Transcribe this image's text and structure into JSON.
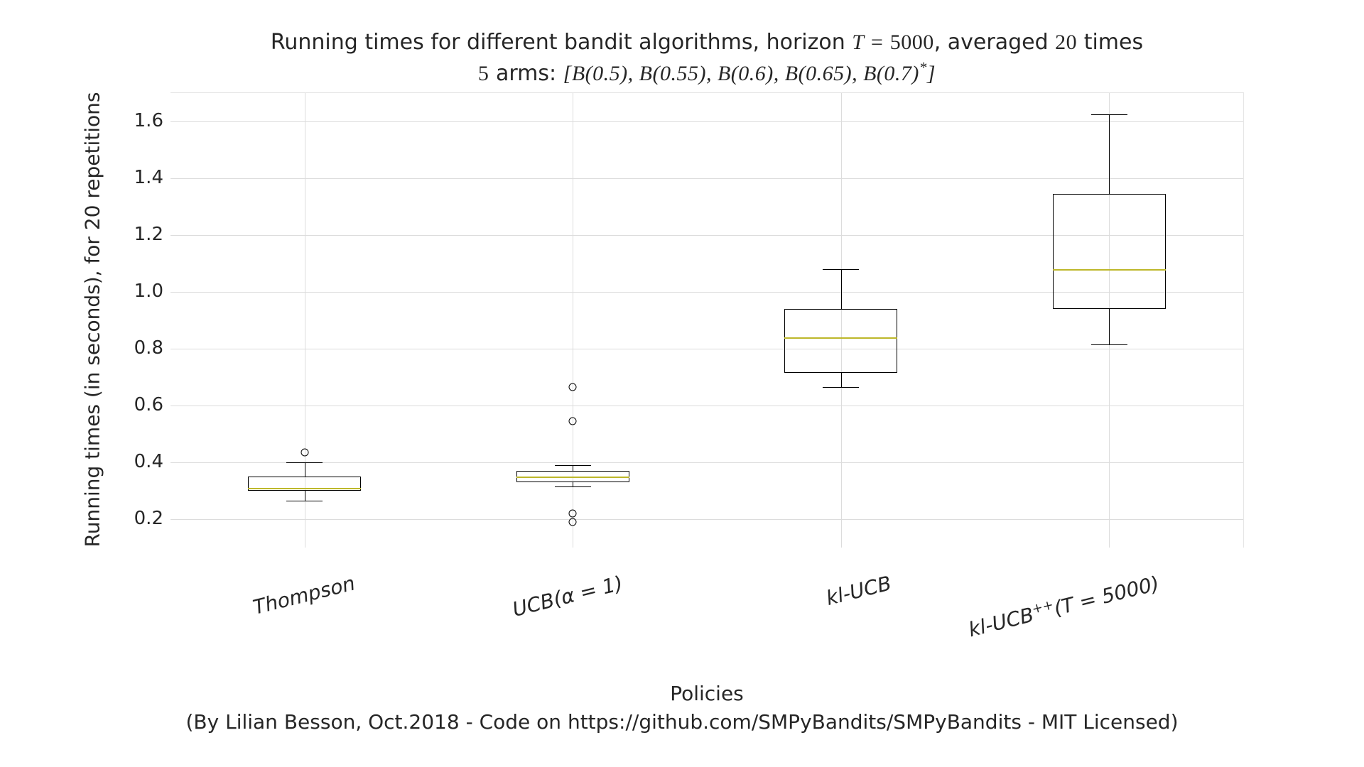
{
  "chart_data": {
    "type": "boxplot",
    "title_line1_pre": "Running times for different bandit algorithms, horizon ",
    "title_line1_T": "T = 5000",
    "title_line1_post": ", averaged ",
    "title_line1_reps": "20",
    "title_line1_end": " times",
    "title_line2_pre": "5",
    "title_line2_mid": " arms: ",
    "title_line2_math": "[B(0.5), B(0.55), B(0.6), B(0.65), B(0.7)*]",
    "xlabel": "Policies",
    "ylabel": "Running times (in seconds), for 20 repetitions",
    "caption": "(By Lilian Besson, Oct.2018 - Code on https://github.com/SMPyBandits/SMPyBandits - MIT Licensed)",
    "ylim": [
      0.1,
      1.7
    ],
    "yticks": [
      0.2,
      0.4,
      0.6,
      0.8,
      1.0,
      1.2,
      1.4,
      1.6
    ],
    "ytick_labels": [
      "0.2",
      "0.4",
      "0.6",
      "0.8",
      "1.0",
      "1.2",
      "1.4",
      "1.6"
    ],
    "categories": [
      "Thompson",
      "UCB(α = 1)",
      "kl-UCB",
      "kl-UCB⁺⁺(T = 5000)"
    ],
    "category_html": [
      "Thompson",
      "UCB(<span style='font-style:italic'>α = 1</span>)",
      "kl-UCB",
      "kl-UCB<sup>++</sup>(<span style='font-style:italic'>T = 5000</span>)"
    ],
    "series": [
      {
        "name": "Thompson",
        "q1": 0.3,
        "median": 0.31,
        "q3": 0.35,
        "whisker_low": 0.265,
        "whisker_high": 0.4,
        "fliers": [
          0.435
        ]
      },
      {
        "name": "UCB(α=1)",
        "q1": 0.33,
        "median": 0.35,
        "q3": 0.37,
        "whisker_low": 0.315,
        "whisker_high": 0.39,
        "fliers": [
          0.19,
          0.22,
          0.545,
          0.665
        ]
      },
      {
        "name": "kl-UCB",
        "q1": 0.715,
        "median": 0.84,
        "q3": 0.94,
        "whisker_low": 0.665,
        "whisker_high": 1.08,
        "fliers": []
      },
      {
        "name": "kl-UCB++ (T=5000)",
        "q1": 0.94,
        "median": 1.08,
        "q3": 1.345,
        "whisker_low": 0.815,
        "whisker_high": 1.625,
        "fliers": []
      }
    ]
  }
}
